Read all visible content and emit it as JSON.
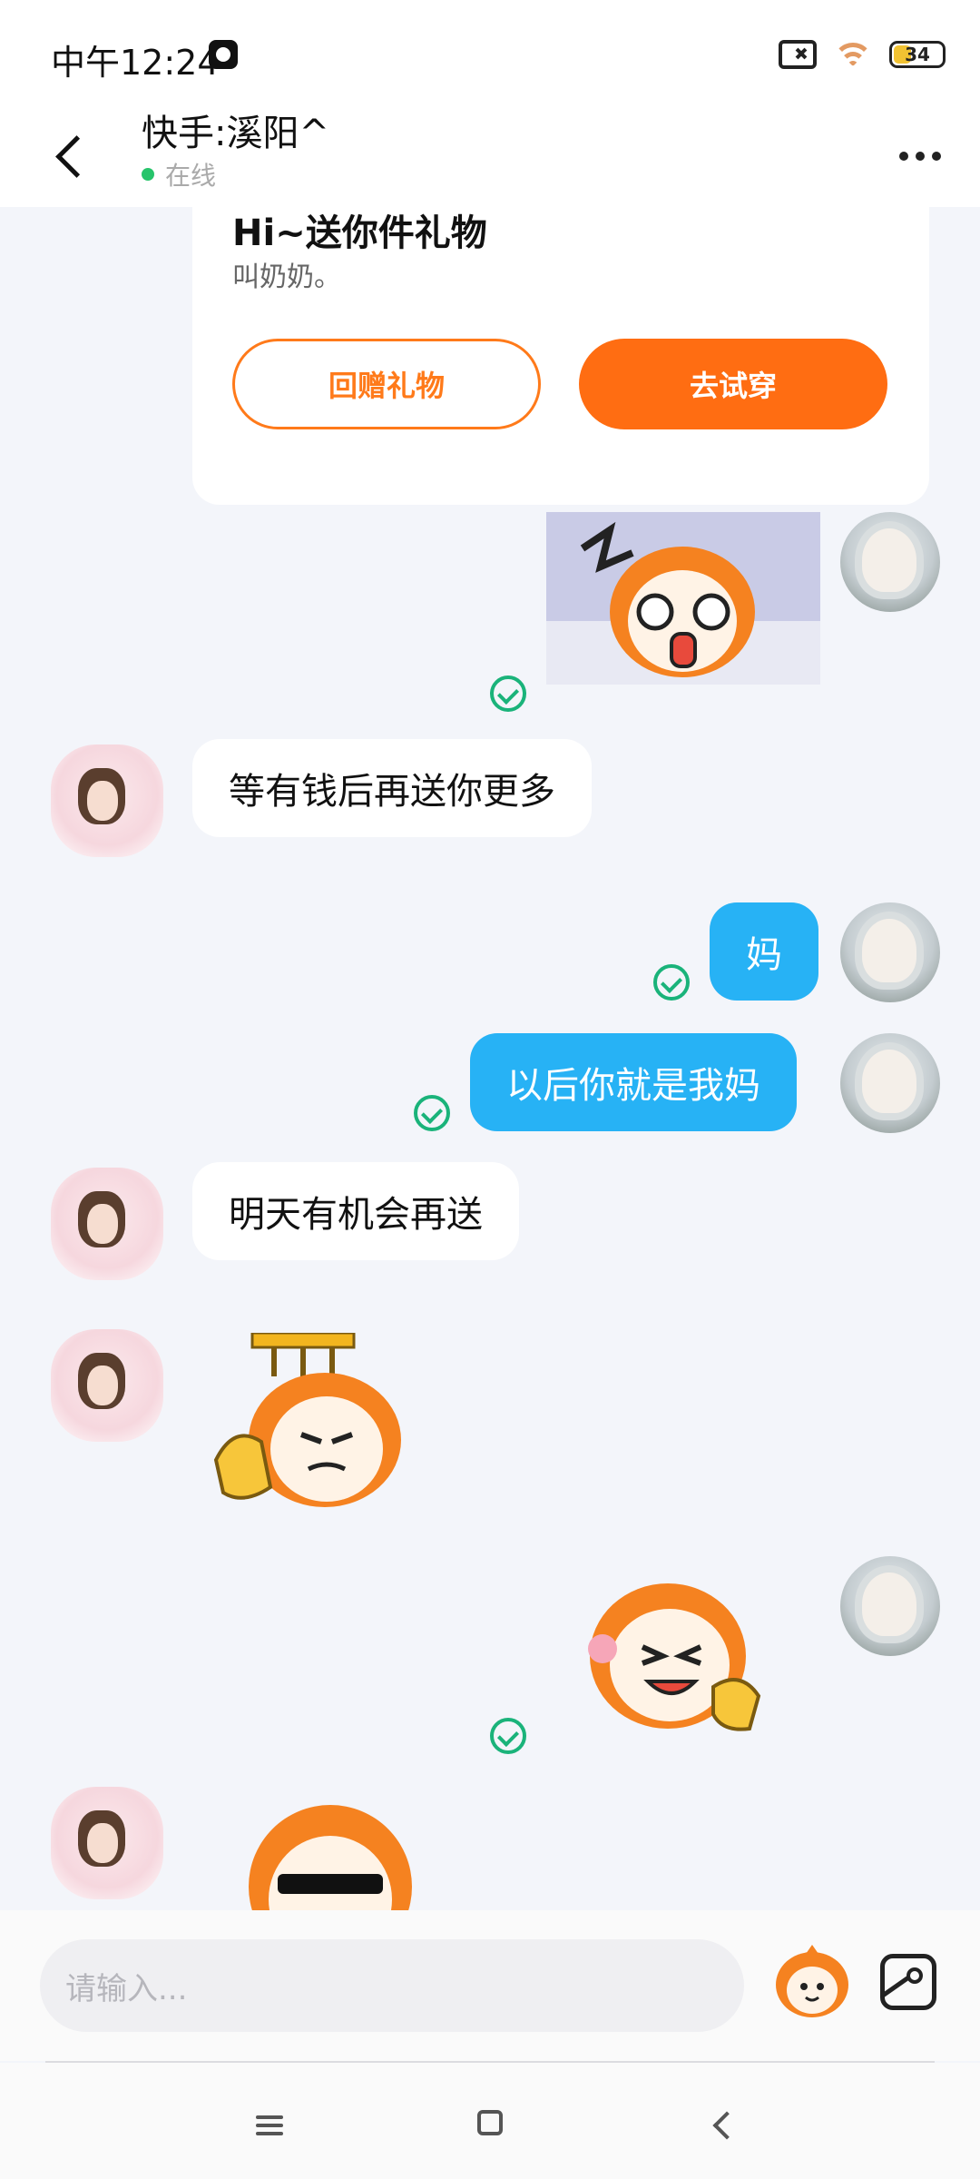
{
  "status_bar": {
    "time": "中午12:24",
    "battery_level": "34",
    "icons": [
      "app-notification-icon",
      "no-sim-icon",
      "wifi-icon",
      "battery-icon"
    ]
  },
  "header": {
    "contact_name": "快手:溪阳^",
    "presence": "在线",
    "icons": [
      "back-arrow-icon",
      "more-dots-icon"
    ]
  },
  "gift_card": {
    "title": "Hi~送你件礼物",
    "subtitle": "叫奶奶。",
    "return_gift_label": "回赠礼物",
    "try_on_label": "去试穿",
    "accent_color": "#ff6d12"
  },
  "messages": [
    {
      "direction": "out",
      "kind": "sticker",
      "sticker": "shocked-face-sticker",
      "read": true
    },
    {
      "direction": "in",
      "kind": "text",
      "text": "等有钱后再送你更多"
    },
    {
      "direction": "out",
      "kind": "text",
      "text": "妈",
      "read": true
    },
    {
      "direction": "out",
      "kind": "text",
      "text": "以后你就是我妈",
      "read": true
    },
    {
      "direction": "in",
      "kind": "text",
      "text": "明天有机会再送"
    },
    {
      "direction": "in",
      "kind": "sticker",
      "sticker": "ok-hand-sticker"
    },
    {
      "direction": "out",
      "kind": "sticker",
      "sticker": "laughing-sticker",
      "read": true
    },
    {
      "direction": "in",
      "kind": "sticker",
      "sticker": "sunglasses-sticker"
    }
  ],
  "input_bar": {
    "placeholder": "请输入...",
    "icons": [
      "emoji-sticker-icon",
      "image-picker-icon"
    ]
  },
  "nav_bar": {
    "icons": [
      "menu-icon",
      "home-icon",
      "back-icon"
    ]
  },
  "colors": {
    "outgoing_bubble": "#27b2f5",
    "incoming_bubble": "#ffffff",
    "read_check": "#1ab37a",
    "online_dot": "#27c46b"
  }
}
